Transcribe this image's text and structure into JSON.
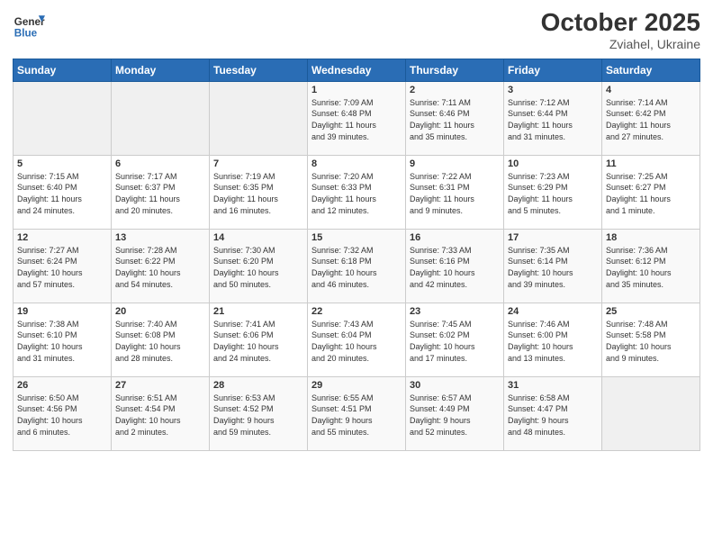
{
  "header": {
    "logo_general": "General",
    "logo_blue": "Blue",
    "month_title": "October 2025",
    "subtitle": "Zviahel, Ukraine"
  },
  "days_of_week": [
    "Sunday",
    "Monday",
    "Tuesday",
    "Wednesday",
    "Thursday",
    "Friday",
    "Saturday"
  ],
  "weeks": [
    [
      {
        "day": "",
        "info": ""
      },
      {
        "day": "",
        "info": ""
      },
      {
        "day": "",
        "info": ""
      },
      {
        "day": "1",
        "info": "Sunrise: 7:09 AM\nSunset: 6:48 PM\nDaylight: 11 hours\nand 39 minutes."
      },
      {
        "day": "2",
        "info": "Sunrise: 7:11 AM\nSunset: 6:46 PM\nDaylight: 11 hours\nand 35 minutes."
      },
      {
        "day": "3",
        "info": "Sunrise: 7:12 AM\nSunset: 6:44 PM\nDaylight: 11 hours\nand 31 minutes."
      },
      {
        "day": "4",
        "info": "Sunrise: 7:14 AM\nSunset: 6:42 PM\nDaylight: 11 hours\nand 27 minutes."
      }
    ],
    [
      {
        "day": "5",
        "info": "Sunrise: 7:15 AM\nSunset: 6:40 PM\nDaylight: 11 hours\nand 24 minutes."
      },
      {
        "day": "6",
        "info": "Sunrise: 7:17 AM\nSunset: 6:37 PM\nDaylight: 11 hours\nand 20 minutes."
      },
      {
        "day": "7",
        "info": "Sunrise: 7:19 AM\nSunset: 6:35 PM\nDaylight: 11 hours\nand 16 minutes."
      },
      {
        "day": "8",
        "info": "Sunrise: 7:20 AM\nSunset: 6:33 PM\nDaylight: 11 hours\nand 12 minutes."
      },
      {
        "day": "9",
        "info": "Sunrise: 7:22 AM\nSunset: 6:31 PM\nDaylight: 11 hours\nand 9 minutes."
      },
      {
        "day": "10",
        "info": "Sunrise: 7:23 AM\nSunset: 6:29 PM\nDaylight: 11 hours\nand 5 minutes."
      },
      {
        "day": "11",
        "info": "Sunrise: 7:25 AM\nSunset: 6:27 PM\nDaylight: 11 hours\nand 1 minute."
      }
    ],
    [
      {
        "day": "12",
        "info": "Sunrise: 7:27 AM\nSunset: 6:24 PM\nDaylight: 10 hours\nand 57 minutes."
      },
      {
        "day": "13",
        "info": "Sunrise: 7:28 AM\nSunset: 6:22 PM\nDaylight: 10 hours\nand 54 minutes."
      },
      {
        "day": "14",
        "info": "Sunrise: 7:30 AM\nSunset: 6:20 PM\nDaylight: 10 hours\nand 50 minutes."
      },
      {
        "day": "15",
        "info": "Sunrise: 7:32 AM\nSunset: 6:18 PM\nDaylight: 10 hours\nand 46 minutes."
      },
      {
        "day": "16",
        "info": "Sunrise: 7:33 AM\nSunset: 6:16 PM\nDaylight: 10 hours\nand 42 minutes."
      },
      {
        "day": "17",
        "info": "Sunrise: 7:35 AM\nSunset: 6:14 PM\nDaylight: 10 hours\nand 39 minutes."
      },
      {
        "day": "18",
        "info": "Sunrise: 7:36 AM\nSunset: 6:12 PM\nDaylight: 10 hours\nand 35 minutes."
      }
    ],
    [
      {
        "day": "19",
        "info": "Sunrise: 7:38 AM\nSunset: 6:10 PM\nDaylight: 10 hours\nand 31 minutes."
      },
      {
        "day": "20",
        "info": "Sunrise: 7:40 AM\nSunset: 6:08 PM\nDaylight: 10 hours\nand 28 minutes."
      },
      {
        "day": "21",
        "info": "Sunrise: 7:41 AM\nSunset: 6:06 PM\nDaylight: 10 hours\nand 24 minutes."
      },
      {
        "day": "22",
        "info": "Sunrise: 7:43 AM\nSunset: 6:04 PM\nDaylight: 10 hours\nand 20 minutes."
      },
      {
        "day": "23",
        "info": "Sunrise: 7:45 AM\nSunset: 6:02 PM\nDaylight: 10 hours\nand 17 minutes."
      },
      {
        "day": "24",
        "info": "Sunrise: 7:46 AM\nSunset: 6:00 PM\nDaylight: 10 hours\nand 13 minutes."
      },
      {
        "day": "25",
        "info": "Sunrise: 7:48 AM\nSunset: 5:58 PM\nDaylight: 10 hours\nand 9 minutes."
      }
    ],
    [
      {
        "day": "26",
        "info": "Sunrise: 6:50 AM\nSunset: 4:56 PM\nDaylight: 10 hours\nand 6 minutes."
      },
      {
        "day": "27",
        "info": "Sunrise: 6:51 AM\nSunset: 4:54 PM\nDaylight: 10 hours\nand 2 minutes."
      },
      {
        "day": "28",
        "info": "Sunrise: 6:53 AM\nSunset: 4:52 PM\nDaylight: 9 hours\nand 59 minutes."
      },
      {
        "day": "29",
        "info": "Sunrise: 6:55 AM\nSunset: 4:51 PM\nDaylight: 9 hours\nand 55 minutes."
      },
      {
        "day": "30",
        "info": "Sunrise: 6:57 AM\nSunset: 4:49 PM\nDaylight: 9 hours\nand 52 minutes."
      },
      {
        "day": "31",
        "info": "Sunrise: 6:58 AM\nSunset: 4:47 PM\nDaylight: 9 hours\nand 48 minutes."
      },
      {
        "day": "",
        "info": ""
      }
    ]
  ]
}
